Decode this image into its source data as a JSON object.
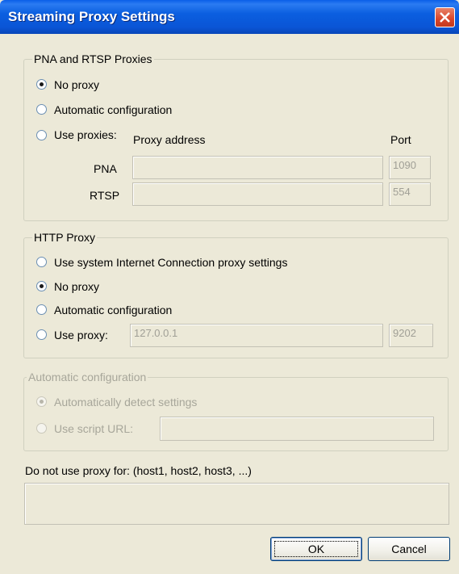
{
  "window": {
    "title": "Streaming Proxy Settings"
  },
  "pna_rtsp": {
    "group_label": "PNA and RTSP Proxies",
    "no_proxy": "No proxy",
    "automatic": "Automatic configuration",
    "use_proxies": "Use proxies:",
    "col_address": "Proxy address",
    "col_port": "Port",
    "pna_label": "PNA",
    "pna_address": "",
    "pna_port": "1090",
    "rtsp_label": "RTSP",
    "rtsp_address": "",
    "rtsp_port": "554",
    "selected": "no_proxy"
  },
  "http": {
    "group_label": "HTTP Proxy",
    "use_system": "Use system Internet Connection proxy settings",
    "no_proxy": "No proxy",
    "automatic": "Automatic configuration",
    "use_proxy": "Use proxy:",
    "proxy_address": "127.0.0.1",
    "proxy_port": "9202",
    "selected": "no_proxy"
  },
  "auto_config": {
    "group_label": "Automatic configuration",
    "detect": "Automatically detect settings",
    "script_url": "Use script URL:",
    "script_value": "",
    "enabled": false
  },
  "bypass": {
    "label": "Do not use proxy for: (host1, host2, host3, ...)",
    "value": ""
  },
  "buttons": {
    "ok": "OK",
    "cancel": "Cancel"
  }
}
